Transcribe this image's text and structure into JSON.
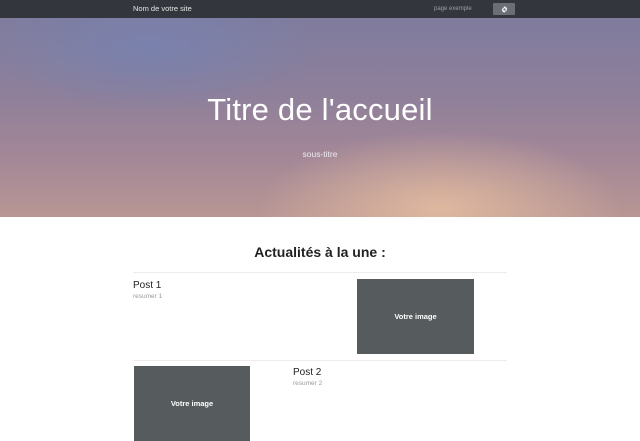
{
  "navbar": {
    "brand": "Nom de votre site",
    "link": "page exemple",
    "button_icon": "gear-icon"
  },
  "hero": {
    "title": "Titre de l'accueil",
    "subtitle": "sous-titre"
  },
  "news": {
    "heading": "Actualités à la une :",
    "posts": [
      {
        "title": "Post 1",
        "summary": "resumer 1",
        "image_label": "Votre image"
      },
      {
        "title": "Post 2",
        "summary": "resumer 2",
        "image_label": "Votre image"
      }
    ]
  },
  "colors": {
    "navbar": "#33373d",
    "image_placeholder": "#565b5d"
  }
}
